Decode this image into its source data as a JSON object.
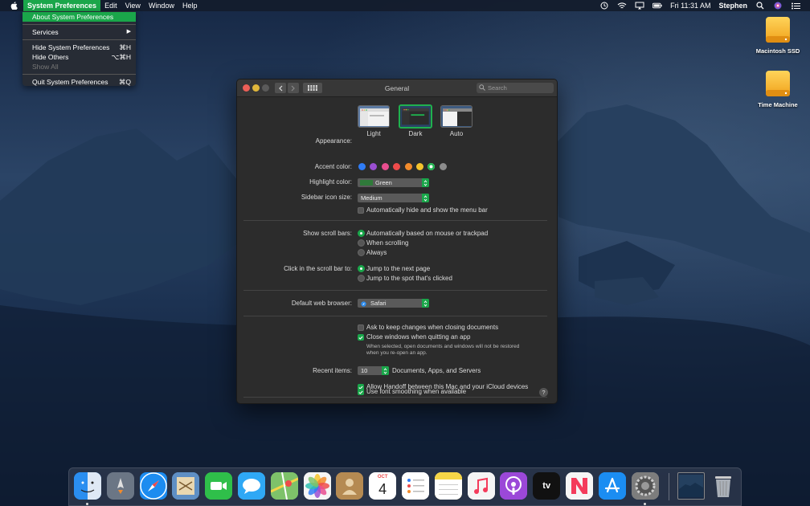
{
  "menubar": {
    "app_name": "System Preferences",
    "menus": [
      "Edit",
      "View",
      "Window",
      "Help"
    ],
    "clock": "Fri 11:31 AM",
    "user": "Stephen"
  },
  "app_menu": {
    "items": [
      {
        "label": "About System Preferences",
        "shortcut": ""
      },
      {
        "label": "Services",
        "shortcut": "▶"
      },
      {
        "label": "Hide System Preferences",
        "shortcut": "⌘H"
      },
      {
        "label": "Hide Others",
        "shortcut": "⌥⌘H"
      },
      {
        "label": "Show All",
        "shortcut": ""
      },
      {
        "label": "Quit System Preferences",
        "shortcut": "⌘Q"
      }
    ]
  },
  "desktop": {
    "icons": [
      {
        "label": "Macintosh SSD"
      },
      {
        "label": "Time Machine"
      }
    ]
  },
  "window": {
    "title": "General",
    "search_placeholder": "Search",
    "appearance": {
      "label": "Appearance:",
      "options": [
        "Light",
        "Dark",
        "Auto"
      ],
      "selected": "Dark"
    },
    "accent": {
      "label": "Accent color:",
      "colors": [
        "#2f7cf6",
        "#9b4fd1",
        "#e84e8f",
        "#ee4b4b",
        "#f28b2c",
        "#f5c32c",
        "#1fb14e",
        "#8c8c8c"
      ],
      "selected": "#1fb14e"
    },
    "highlight": {
      "label": "Highlight color:",
      "value": "Green",
      "swatch": "#2f7a3a"
    },
    "sidebar_size": {
      "label": "Sidebar icon size:",
      "value": "Medium"
    },
    "auto_hide_menubar": {
      "label": "Automatically hide and show the menu bar",
      "checked": false
    },
    "scroll_bars": {
      "label": "Show scroll bars:",
      "options": [
        "Automatically based on mouse or trackpad",
        "When scrolling",
        "Always"
      ],
      "selected": 0
    },
    "scroll_click": {
      "label": "Click in the scroll bar to:",
      "options": [
        "Jump to the next page",
        "Jump to the spot that's clicked"
      ],
      "selected": 0
    },
    "browser": {
      "label": "Default web browser:",
      "value": "Safari"
    },
    "ask_keep": {
      "label": "Ask to keep changes when closing documents",
      "checked": false
    },
    "close_windows": {
      "label": "Close windows when quitting an app",
      "checked": true,
      "note_line1": "When selected, open documents and windows will not be restored",
      "note_line2": "when you re-open an app."
    },
    "recent": {
      "label": "Recent items:",
      "value": "10",
      "suffix": "Documents, Apps, and Servers"
    },
    "handoff": {
      "label": "Allow Handoff between this Mac and your iCloud devices",
      "checked": true
    },
    "font_smoothing": {
      "label": "Use font smoothing when available",
      "checked": true
    },
    "help": "?"
  },
  "dock": {
    "apps": [
      {
        "name": "finder-icon",
        "bg": "#2a8ef0"
      },
      {
        "name": "launchpad-icon",
        "bg": "#6b7685"
      },
      {
        "name": "safari-icon",
        "bg": "#1c8cf0"
      },
      {
        "name": "mail-icon",
        "bg": "#5f8fc4"
      },
      {
        "name": "facetime-icon",
        "bg": "#2fbf4a"
      },
      {
        "name": "messages-icon",
        "bg": "#2fa8f5"
      },
      {
        "name": "maps-icon",
        "bg": "#7ec26a"
      },
      {
        "name": "photos-icon",
        "bg": "#f0f0f0"
      },
      {
        "name": "contacts-icon",
        "bg": "#b58a52"
      },
      {
        "name": "calendar-icon",
        "bg": "#ffffff"
      },
      {
        "name": "reminders-icon",
        "bg": "#ffffff"
      },
      {
        "name": "notes-icon",
        "bg": "#f5d547"
      },
      {
        "name": "music-icon",
        "bg": "#f5f5f5"
      },
      {
        "name": "podcasts-icon",
        "bg": "#9b48d8"
      },
      {
        "name": "tv-icon",
        "bg": "#111111"
      },
      {
        "name": "news-icon",
        "bg": "#f5f5f5"
      },
      {
        "name": "app-store-icon",
        "bg": "#1b8df2"
      },
      {
        "name": "system-preferences-icon",
        "bg": "#7d7d7d"
      }
    ],
    "calendar_month": "OCT",
    "calendar_day": "4",
    "tv_label": "tv"
  }
}
